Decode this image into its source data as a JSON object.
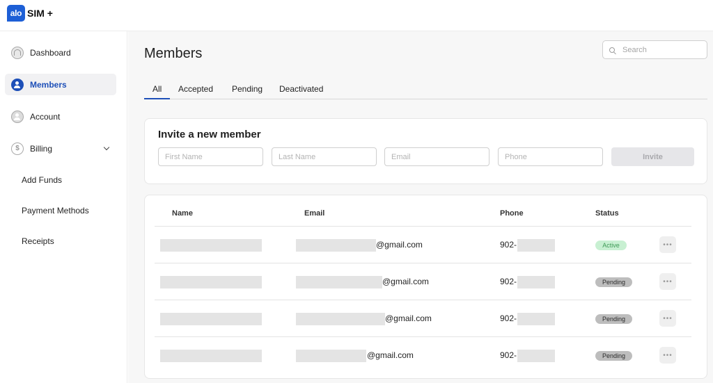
{
  "brand": {
    "badge": "alo",
    "name": "SIM +"
  },
  "sidebar": {
    "items": [
      {
        "label": "Dashboard",
        "icon": "dashboard-icon"
      },
      {
        "label": "Members",
        "icon": "user-icon",
        "active": true
      },
      {
        "label": "Account",
        "icon": "user-icon"
      },
      {
        "label": "Billing",
        "icon": "dollar-icon",
        "expanded": true
      }
    ],
    "billing_sub": [
      "Add Funds",
      "Payment Methods",
      "Receipts"
    ]
  },
  "page": {
    "title": "Members"
  },
  "search": {
    "placeholder": "Search"
  },
  "tabs": [
    "All",
    "Accepted",
    "Pending",
    "Deactivated"
  ],
  "invite": {
    "title": "Invite a new member",
    "first_name_placeholder": "First Name",
    "last_name_placeholder": "Last Name",
    "email_placeholder": "Email",
    "phone_placeholder": "Phone",
    "button": "Invite"
  },
  "table": {
    "headers": {
      "name": "Name",
      "email": "Email",
      "phone": "Phone",
      "status": "Status"
    },
    "rows": [
      {
        "email_suffix": "@gmail.com",
        "phone_prefix": "902-",
        "status": "Active"
      },
      {
        "email_suffix": "@gmail.com",
        "phone_prefix": "902-",
        "status": "Pending"
      },
      {
        "email_suffix": "@gmail.com",
        "phone_prefix": "902-",
        "status": "Pending"
      },
      {
        "email_suffix": "@gmail.com",
        "phone_prefix": "902-",
        "status": "Pending"
      }
    ],
    "more_label": "•••"
  },
  "colors": {
    "accent": "#1d4fb8",
    "brand": "#1d5fd6",
    "active_badge": "#c8f0d2",
    "pending_badge": "#bdbdbd"
  }
}
